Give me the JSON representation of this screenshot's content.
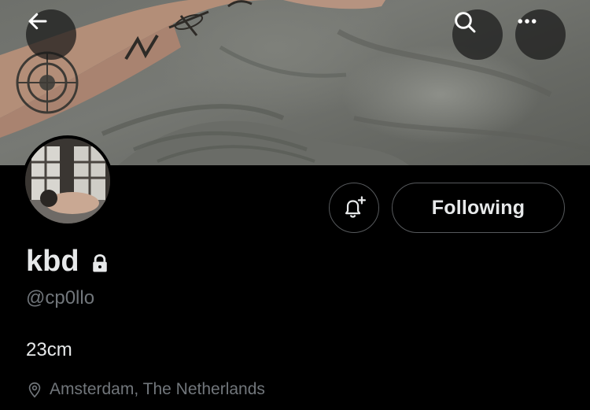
{
  "profile": {
    "display_name": "kbd",
    "handle": "@cp0llo",
    "bio": "23cm",
    "location": "Amsterdam, The Netherlands",
    "protected": true
  },
  "actions": {
    "follow_state_label": "Following"
  },
  "icons": {
    "back": "arrow-left-icon",
    "search": "search-icon",
    "more": "more-horizontal-icon",
    "notify": "bell-plus-icon",
    "lock": "lock-icon",
    "location": "map-pin-icon"
  },
  "colors": {
    "background": "#000000",
    "primary_text": "#e7e9ea",
    "secondary_text": "#71767b",
    "button_border": "#56595c"
  }
}
